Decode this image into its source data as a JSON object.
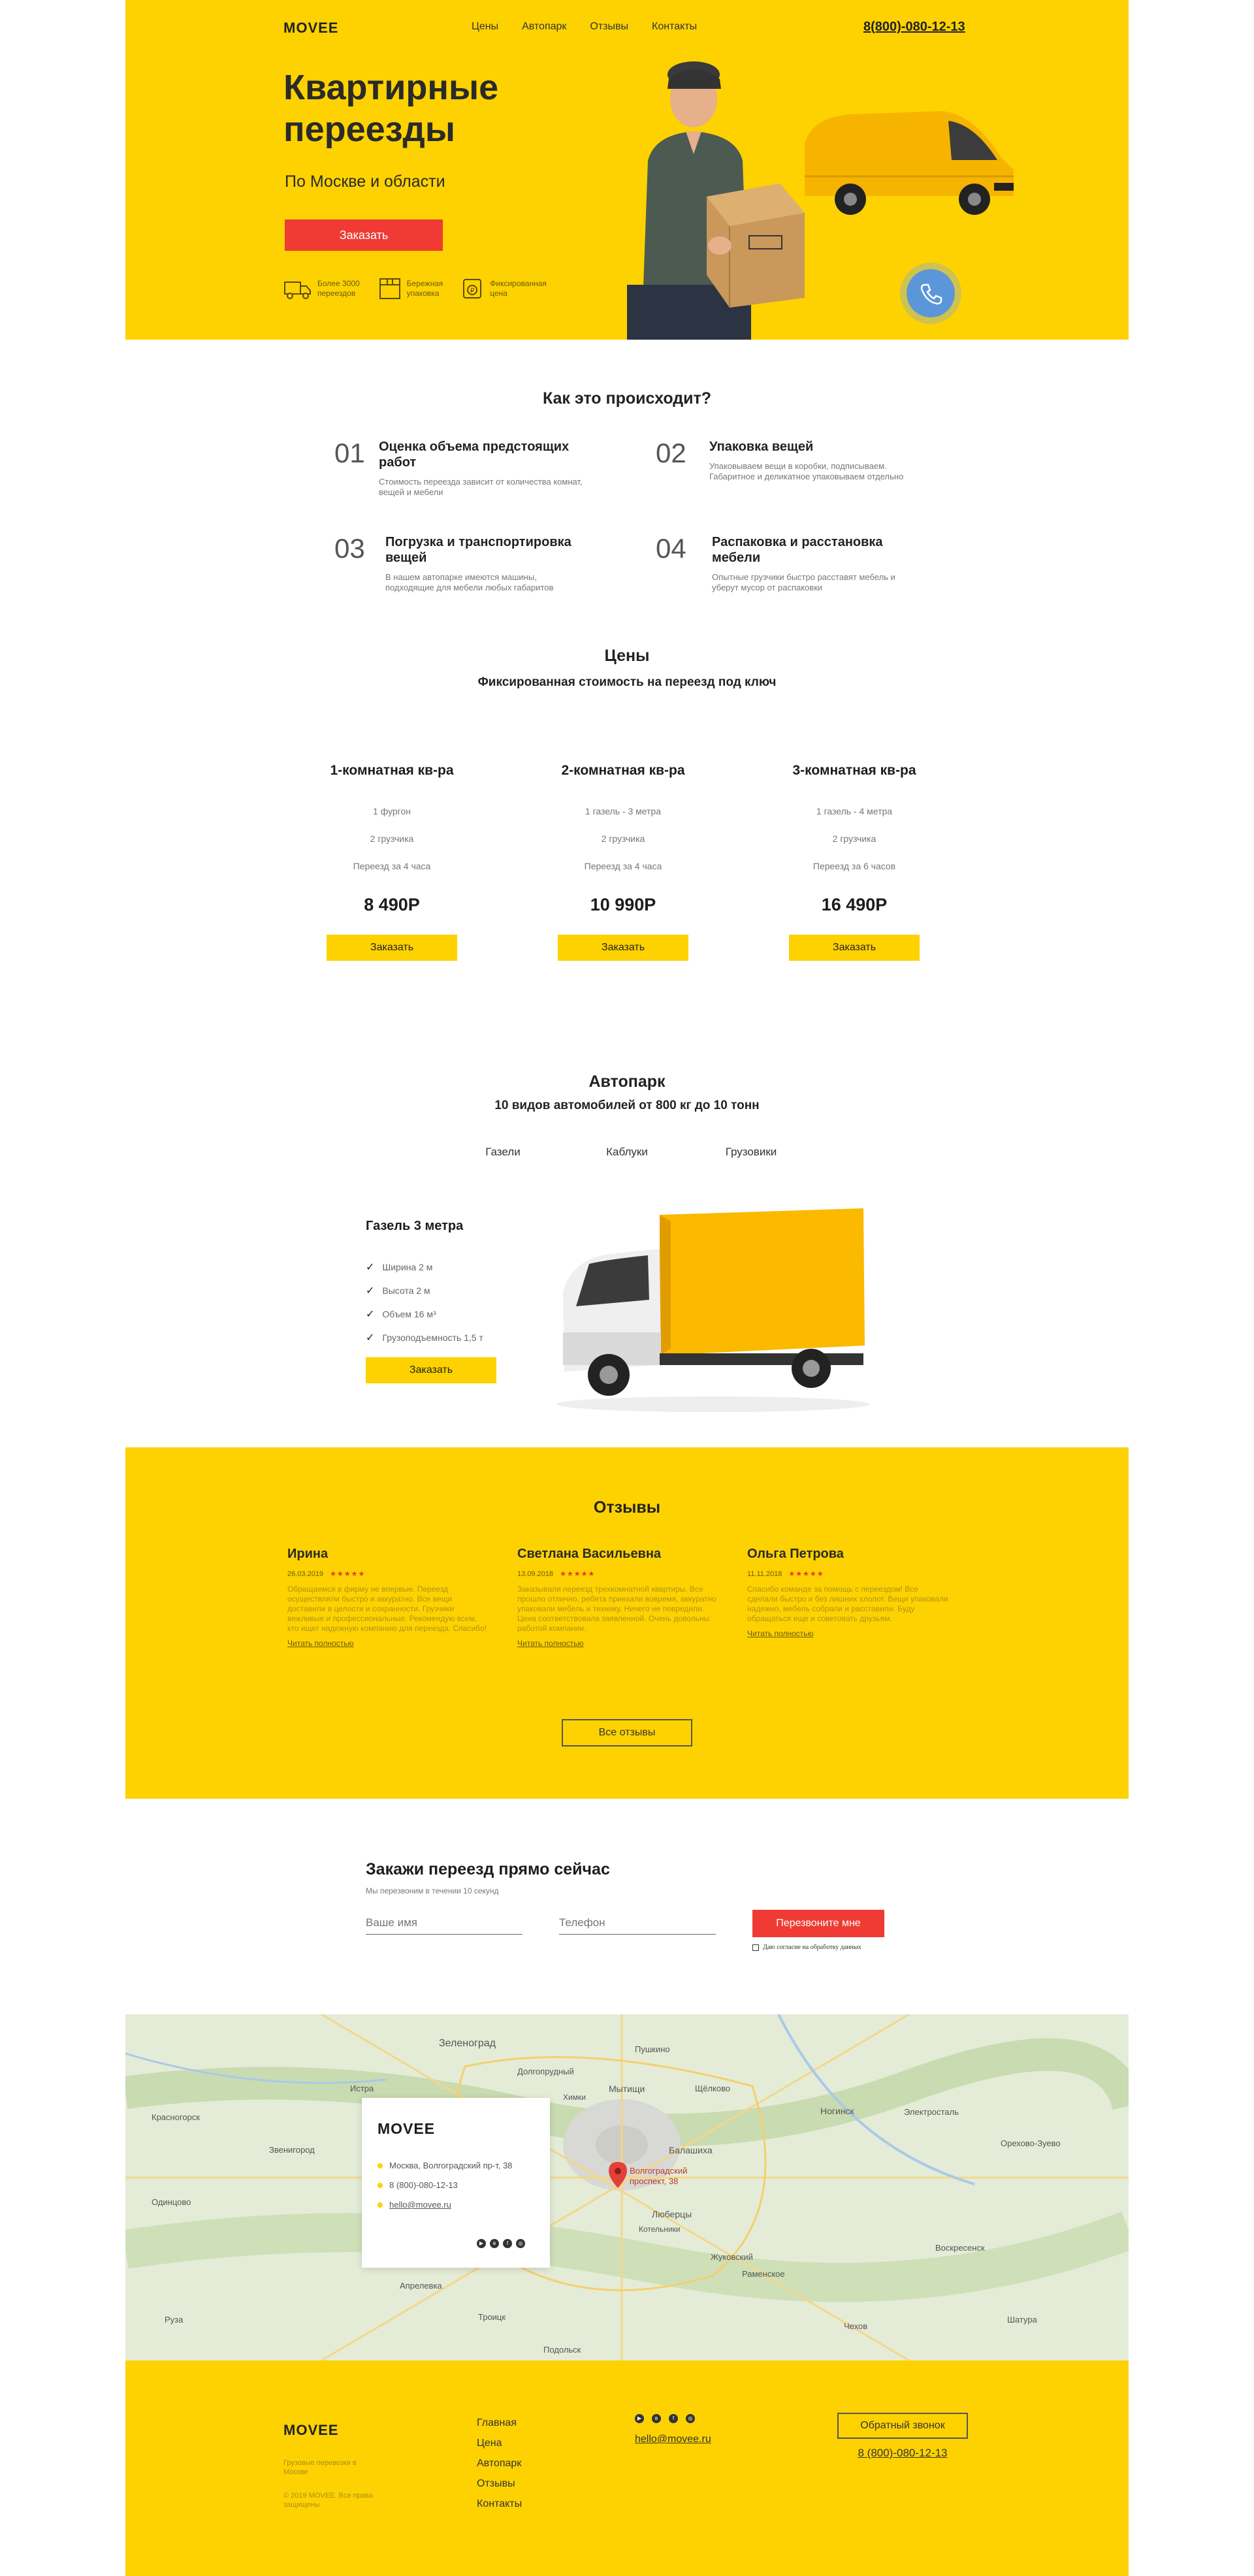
{
  "header": {
    "logo": "MOVEE",
    "nav": [
      "Цены",
      "Автопарк",
      "Отзывы",
      "Контакты"
    ],
    "phone": "8(800)-080-12-13"
  },
  "hero": {
    "title_line1": "Квартирные",
    "title_line2": "переезды",
    "subtitle": "По Москве и области",
    "cta": "Заказать",
    "features": [
      {
        "icon": "truck-icon",
        "line1": "Более 3000",
        "line2": "переездов"
      },
      {
        "icon": "box-icon",
        "line1": "Бережная",
        "line2": "упаковка"
      },
      {
        "icon": "price-tag-icon",
        "line1": "Фиксированная",
        "line2": "цена"
      }
    ]
  },
  "process": {
    "title": "Как это происходит?",
    "steps": [
      {
        "num": "01",
        "title": "Оценка объема предстоящих работ",
        "text": "Стоимость переезда зависит от количества комнат, вещей и мебели"
      },
      {
        "num": "02",
        "title": "Упаковка вещей",
        "text": "Упаковываем вещи в коробки, подписываем. Габаритное и деликатное упаковываем отдельно"
      },
      {
        "num": "03",
        "title": "Погрузка и транспортировка вещей",
        "text": "В нашем автопарке имеются машины, подходящие для мебели любых габаритов"
      },
      {
        "num": "04",
        "title": "Распаковка и расстановка мебели",
        "text": "Опытные грузчики быстро расставят мебель и уберут мусор от распаковки"
      }
    ]
  },
  "prices": {
    "title": "Цены",
    "subtitle": "Фиксированная стоимость на переезд под ключ",
    "plans": [
      {
        "name": "1-комнатная кв-ра",
        "car": "1 фургон",
        "movers": "2 грузчика",
        "time": "Переезд за 4 часа",
        "price": "8 490Р",
        "button": "Заказать"
      },
      {
        "name": "2-комнатная кв-ра",
        "car": "1 газель - 3 метра",
        "movers": "2 грузчика",
        "time": "Переезд за 4 часа",
        "price": "10 990Р",
        "button": "Заказать"
      },
      {
        "name": "3-комнатная кв-ра",
        "car": "1 газель - 4 метра",
        "movers": "2 грузчика",
        "time": "Переезд за 6 часов",
        "price": "16 490Р",
        "button": "Заказать"
      }
    ]
  },
  "fleet": {
    "title": "Автопарк",
    "subtitle": "10 видов автомобилей от 800 кг до 10 тонн",
    "tabs": [
      "Газели",
      "Каблуки",
      "Грузовики"
    ],
    "car_name": "Газель 3 метра",
    "specs": [
      "Ширина 2 м",
      "Высота 2 м",
      "Объем 16 м³",
      "Грузоподъемность 1,5 т"
    ],
    "button": "Заказать"
  },
  "reviews": {
    "title": "Отзывы",
    "items": [
      {
        "name": "Ирина",
        "date": "26.03.2019",
        "stars": "★★★★★",
        "text": "Обращаемся в фирму не впервые. Переезд осуществляли быстро и аккуратно. Все вещи доставили в целости и сохранности. Грузчики вежливые и профессиональные. Рекомендую всем, кто ищет надежную компанию для переезда. Спасибо!",
        "link": "Читать полностью"
      },
      {
        "name": "Светлана Васильевна",
        "date": "13.09.2018",
        "stars": "★★★★★",
        "text": "Заказывали переезд трехкомнатной квартиры. Все прошло отлично, ребята приехали вовремя, аккуратно упаковали мебель и технику. Ничего не повредили. Цена соответствовала заявленной. Очень довольны работой компании.",
        "link": "Читать полностью"
      },
      {
        "name": "Ольга Петрова",
        "date": "11.11.2018",
        "stars": "★★★★★",
        "text": "Спасибо команде за помощь с переездом! Все сделали быстро и без лишних хлопот. Вещи упаковали надежно, мебель собрали и расставили. Буду обращаться еще и советовать друзьям.",
        "link": "Читать полностью"
      }
    ],
    "button": "Все отзывы"
  },
  "order": {
    "title": "Закажи переезд прямо сейчас",
    "subtitle": "Мы перезвоним в течении 10 секунд",
    "name_placeholder": "Ваше имя",
    "phone_placeholder": "Телефон",
    "button": "Перезвоните мне",
    "consent": "Даю согласие на обработку данных"
  },
  "map": {
    "card_logo": "MOVEE",
    "address": "Москва, Волгоградский пр-т, 38",
    "phone": "8 (800)-080-12-13",
    "email": "hello@movee.ru",
    "marker_label_1": "Волгоградский",
    "marker_label_2": "проспект, 38",
    "cities": [
      "Зеленоград",
      "Долгопрудный",
      "Мытищи",
      "Пушкино",
      "Щёлково",
      "Балашиха",
      "Люберцы",
      "Котельники",
      "Жуковский",
      "Раменское",
      "Подольск",
      "Троицк",
      "Апрелевка",
      "Звенигород",
      "Истра",
      "Ногинск",
      "Электросталь",
      "Орехово-Зуево",
      "Воскресенск",
      "Химки",
      "Красногорск",
      "Одинцово",
      "Руза",
      "Чехов",
      "Шатура"
    ]
  },
  "footer": {
    "logo": "MOVEE",
    "small1": "Грузовые перевозки в Москве",
    "small2": "© 2019 MOVEE. Все права защищены",
    "links": [
      "Главная",
      "Цена",
      "Автопарк",
      "Отзывы",
      "Контакты"
    ],
    "email": "hello@movee.ru",
    "callback": "Обратный звонок",
    "phone": "8 (800)-080-12-13"
  },
  "colors": {
    "brand_yellow": "#fed200",
    "accent_red": "#ef3b34"
  }
}
